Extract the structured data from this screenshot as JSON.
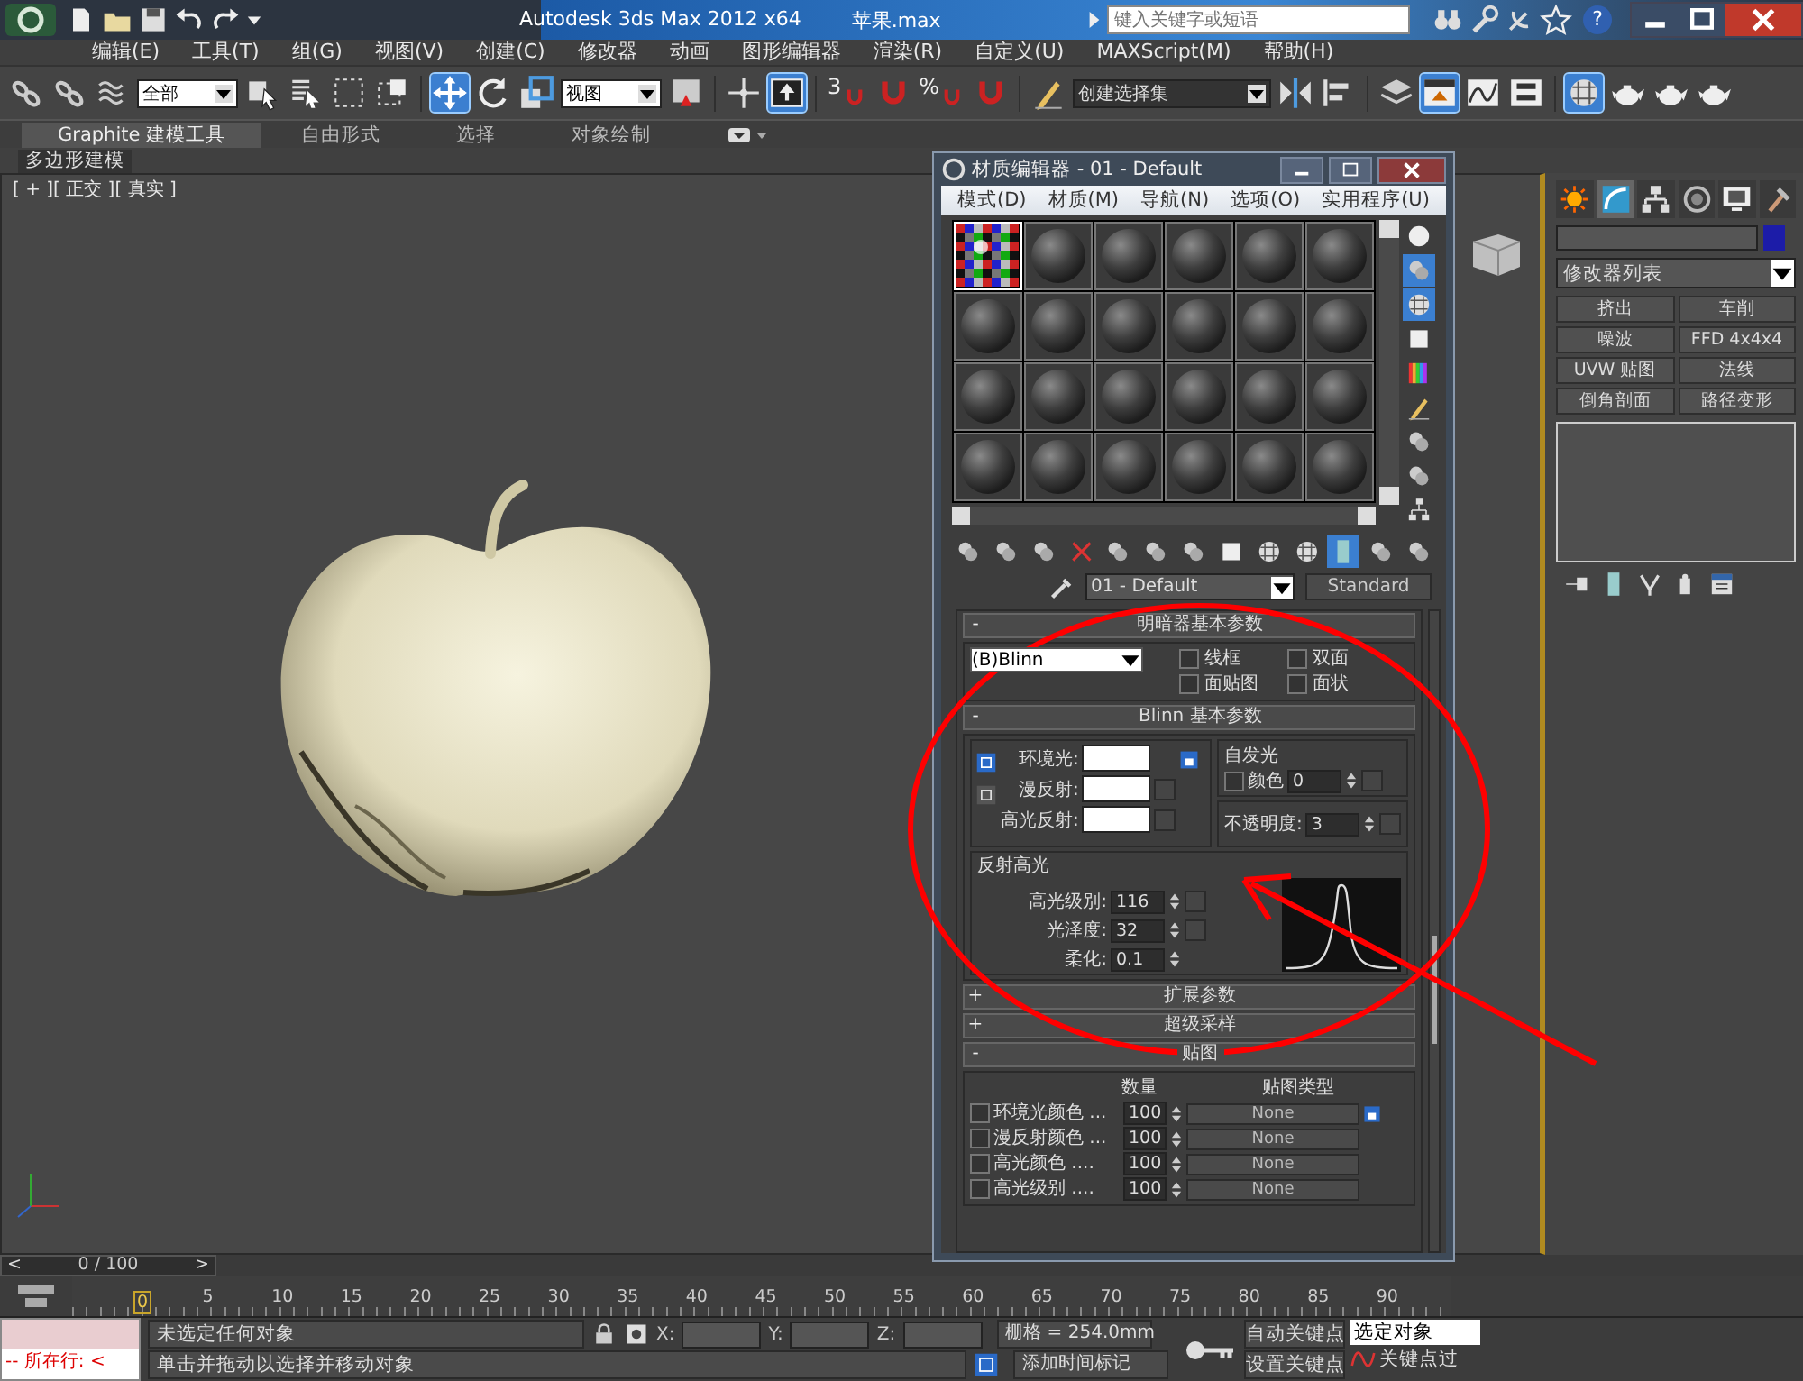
{
  "title_bar": {
    "title": "Autodesk 3ds Max  2012 x64",
    "file": "苹果.max",
    "search": {
      "placeholder": "键入关键字或短语"
    },
    "help": "?"
  },
  "menu": [
    "编辑(E)",
    "工具(T)",
    "组(G)",
    "视图(V)",
    "创建(C)",
    "修改器",
    "动画",
    "图形编辑器",
    "渲染(R)",
    "自定义(U)",
    "MAXScript(M)",
    "帮助(H)"
  ],
  "toolbar": {
    "selection_filter": "全部",
    "reference_coordinates": "视图",
    "snap_toggle": "3",
    "percent_snap": "%",
    "named_selection": "创建选择集",
    "buttons": [
      {
        "active": false
      },
      {
        "active": false
      },
      {
        "active": false
      },
      {
        "active": false
      },
      {
        "active": false
      },
      {
        "active": false
      },
      {
        "active": false
      },
      {
        "active": true
      },
      {
        "active": false
      },
      {
        "active": false
      },
      {
        "active": false
      },
      {
        "active": false
      },
      {
        "active": true
      },
      {
        "active": false
      },
      {
        "active": false
      },
      {
        "active": false
      },
      {
        "active": false
      },
      {
        "active": false
      },
      {
        "active": false
      },
      {
        "active": false
      },
      {
        "active": false
      },
      {
        "active": true
      },
      {
        "active": false
      },
      {
        "active": false
      },
      {
        "active": true
      },
      {
        "active": false
      },
      {
        "active": false
      },
      {
        "active": false
      }
    ]
  },
  "ribbon": {
    "tabs": [
      {
        "label": "Graphite 建模工具",
        "selected": true
      },
      {
        "label": "自由形式",
        "selected": false
      },
      {
        "label": "选择",
        "selected": false
      },
      {
        "label": "对象绘制",
        "selected": false
      }
    ],
    "panel": "多边形建模"
  },
  "viewport": {
    "label": "[ + ][ 正交 ][ 真实 ]"
  },
  "material_editor": {
    "title": "材质编辑器 - 01 - Default",
    "menu": [
      "模式(D)",
      "材质(M)",
      "导航(N)",
      "选项(O)",
      "实用程序(U)"
    ],
    "slots": [
      {
        "kind": "checker",
        "selected": true
      },
      {
        "kind": "sphere",
        "selected": false
      },
      {
        "kind": "sphere",
        "selected": false
      },
      {
        "kind": "sphere",
        "selected": false
      },
      {
        "kind": "sphere",
        "selected": false
      },
      {
        "kind": "sphere",
        "selected": false
      },
      {
        "kind": "sphere",
        "selected": false
      },
      {
        "kind": "sphere",
        "selected": false
      },
      {
        "kind": "sphere",
        "selected": false
      },
      {
        "kind": "sphere",
        "selected": false
      },
      {
        "kind": "sphere",
        "selected": false
      },
      {
        "kind": "sphere",
        "selected": false
      },
      {
        "kind": "sphere",
        "selected": false
      },
      {
        "kind": "sphere",
        "selected": false
      },
      {
        "kind": "sphere",
        "selected": false
      },
      {
        "kind": "sphere",
        "selected": false
      },
      {
        "kind": "sphere",
        "selected": false
      },
      {
        "kind": "sphere",
        "selected": false
      },
      {
        "kind": "sphere",
        "selected": false
      },
      {
        "kind": "sphere",
        "selected": false
      },
      {
        "kind": "sphere",
        "selected": false
      },
      {
        "kind": "sphere",
        "selected": false
      },
      {
        "kind": "sphere",
        "selected": false
      },
      {
        "kind": "sphere",
        "selected": false
      }
    ],
    "side_tools": [
      {
        "active": false
      },
      {
        "active": true
      },
      {
        "active": true
      },
      {
        "active": false
      },
      {
        "active": false
      },
      {
        "active": false
      },
      {
        "active": false
      },
      {
        "active": false
      },
      {
        "active": false
      }
    ],
    "bottom_tools": [
      {
        "active": false
      },
      {
        "active": false
      },
      {
        "active": false
      },
      {
        "active": false
      },
      {
        "active": false
      },
      {
        "active": false
      },
      {
        "active": false
      },
      {
        "active": false
      },
      {
        "active": false
      },
      {
        "active": false
      },
      {
        "active": true
      },
      {
        "active": false
      },
      {
        "active": false
      }
    ],
    "material_name": "01 - Default",
    "material_type": "Standard",
    "shader_rollout": {
      "toggle": "-",
      "title": "明暗器基本参数",
      "shader": "(B)Blinn",
      "options": [
        {
          "label": "线框",
          "checked": false
        },
        {
          "label": "双面",
          "checked": false
        },
        {
          "label": "面贴图",
          "checked": false
        },
        {
          "label": "面状",
          "checked": false
        }
      ]
    },
    "blinn_rollout": {
      "toggle": "-",
      "title": "Blinn 基本参数",
      "colors": [
        "环境光:",
        "漫反射:",
        "高光反射:"
      ],
      "self_illumination": {
        "title": "自发光",
        "label": "颜色",
        "checked": false,
        "value": "0"
      },
      "opacity": {
        "label": "不透明度:",
        "value": "3"
      },
      "specular": {
        "title": "反射高光",
        "rows": [
          {
            "label": "高光级别:",
            "value": "116"
          },
          {
            "label": "光泽度:",
            "value": "32"
          },
          {
            "label": "柔化:",
            "value": "0.1"
          }
        ]
      }
    },
    "collapsed_rollouts": [
      {
        "toggle": "+",
        "title": "扩展参数"
      },
      {
        "toggle": "+",
        "title": "超级采样"
      }
    ],
    "maps_rollout": {
      "toggle": "-",
      "title": "贴图",
      "columns": [
        "数量",
        "贴图类型"
      ],
      "rows": [
        {
          "label": "环境光颜色 ...",
          "checked": false,
          "amount": "100",
          "map": "None"
        },
        {
          "label": "漫反射颜色 ...",
          "checked": false,
          "amount": "100",
          "map": "None"
        },
        {
          "label": "高光颜色 ....",
          "checked": false,
          "amount": "100",
          "map": "None"
        },
        {
          "label": "高光级别 ....",
          "checked": false,
          "amount": "100",
          "map": "None"
        }
      ]
    }
  },
  "command_panel": {
    "tabs": [
      {
        "selected": false
      },
      {
        "selected": true
      },
      {
        "selected": false
      },
      {
        "selected": false
      },
      {
        "selected": false
      },
      {
        "selected": false
      }
    ],
    "modifier_list": "修改器列表",
    "modifiers": [
      "挤出",
      "车削",
      "噪波",
      "FFD 4x4x4",
      "UVW 贴图",
      "法线",
      "倒角剖面",
      "路径变形"
    ]
  },
  "timeline": {
    "prev": "<",
    "position": "0 / 100",
    "next": ">",
    "ruler": [
      "0",
      "5",
      "10",
      "15",
      "20",
      "25",
      "30",
      "35",
      "40",
      "45",
      "50",
      "55",
      "60",
      "65",
      "70",
      "75",
      "80",
      "85",
      "90"
    ]
  },
  "status": {
    "listener": "--  所在行:  <",
    "selection": "未选定任何对象",
    "prompt": "单击并拖动以选择并移动对象",
    "x_label": "X:",
    "y_label": "Y:",
    "z_label": "Z:",
    "grid": "栅格 = 254.0mm",
    "auto_key": "自动关键点",
    "key_mode": "选定对象",
    "set_key": "设置关键点",
    "add_time_tag": "添加时间标记",
    "key_filters": "关键点过"
  },
  "annotations": [
    {
      "kind": "ellipse"
    },
    {
      "kind": "arrow"
    }
  ]
}
